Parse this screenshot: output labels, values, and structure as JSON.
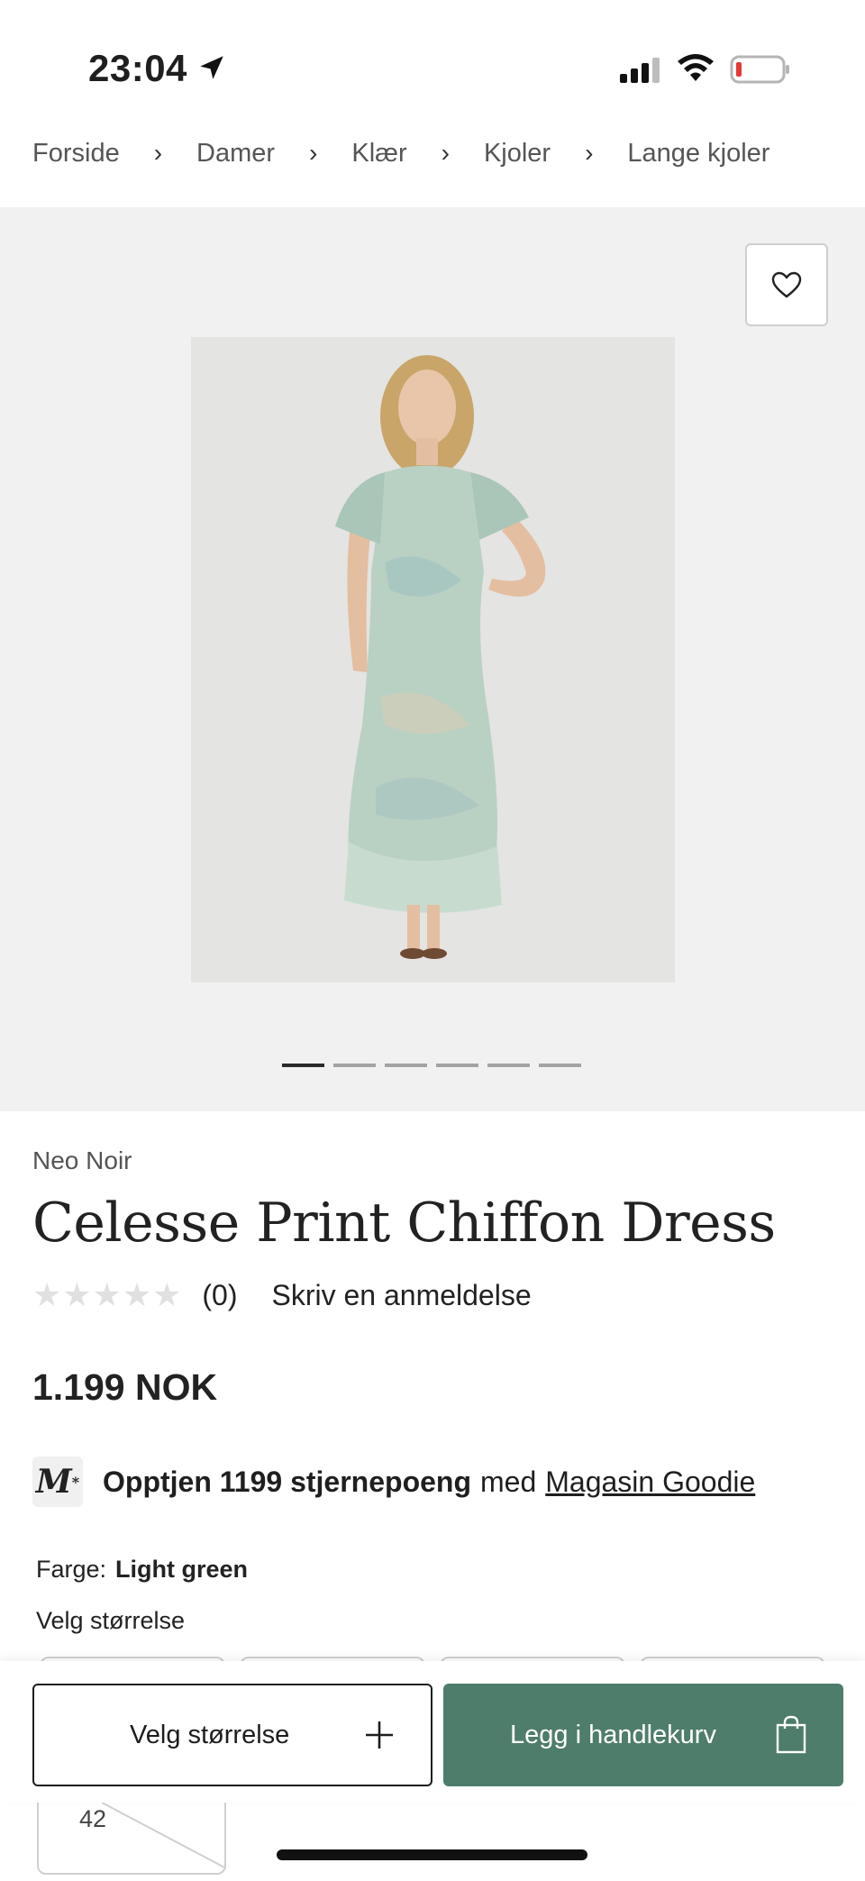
{
  "status_bar": {
    "time": "23:04"
  },
  "breadcrumb": [
    "Forside",
    "Damer",
    "Klær",
    "Kjoler",
    "Lange kjoler"
  ],
  "breadcrumb_separator": "›",
  "gallery": {
    "image_count": 6,
    "active_index": 0
  },
  "product": {
    "brand": "Neo Noir",
    "title": "Celesse Print Chiffon Dress",
    "rating_stars": "★★★★★",
    "rating_count": "(0)",
    "review_link": "Skriv en anmeldelse",
    "price": "1.199 NOK"
  },
  "goodie": {
    "logo_letter": "M",
    "logo_star": "*",
    "bold_text": "Opptjen 1199 stjernepoeng",
    "text": "med",
    "link": "Magasin Goodie"
  },
  "color": {
    "label": "Farge:",
    "value": "Light green"
  },
  "size_section": {
    "label": "Velg størrelse",
    "visible_size": "42"
  },
  "actions": {
    "select_size": "Velg størrelse",
    "add_to_cart": "Legg i handlekurv"
  },
  "colors": {
    "accent": "#4e7d6b",
    "gallery_bg": "#f1f1f1"
  }
}
